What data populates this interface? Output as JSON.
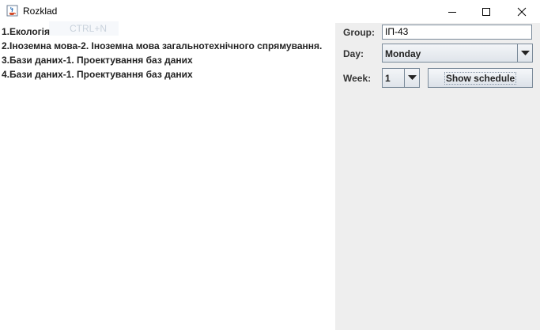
{
  "window": {
    "title": "Rozklad",
    "icon": "java-cup-icon"
  },
  "menu_hint": {
    "shortcut": "CTRL+N"
  },
  "schedule": {
    "lessons": [
      "1.Екологія",
      "2.Іноземна мова-2. Іноземна мова загальнотехнічного спрямування.",
      "3.Бази даних-1. Проектування баз даних",
      "4.Бази даних-1. Проектування баз даних"
    ]
  },
  "controls": {
    "group_label": "Group:",
    "group_value": "ІП-43",
    "day_label": "Day:",
    "day_value": "Monday",
    "week_label": "Week:",
    "week_value": "1",
    "show_button": "Show schedule"
  }
}
